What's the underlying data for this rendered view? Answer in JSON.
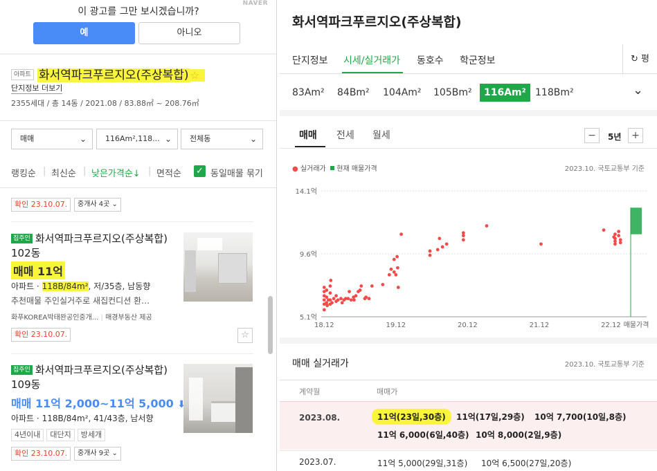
{
  "ad": {
    "question": "이 광고를 그만 보시겠습니까?",
    "brand": "NAVER",
    "yes": "예",
    "no": "아니오"
  },
  "complex": {
    "type_badge": "아파트",
    "name": "화서역파크푸르지오(주상복합)",
    "star": "☆",
    "more_info": "단지정보 더보기",
    "summary": "2355세대 / 총 14동 / 2021.08 / 83.88㎡ ~ 208.76㎡"
  },
  "filters": {
    "deal": "매매",
    "area": "116Am²,118...",
    "dong": "전체동"
  },
  "sort": {
    "rank": "랭킹순",
    "latest": "최신순",
    "cheap": "낮은가격순↓",
    "area": "면적순",
    "group": "동일매물 묶기"
  },
  "listings": [
    {
      "confirm": "확인 23.10.07.",
      "broker": "중개사 4곳"
    },
    {
      "badge": "집주인",
      "title": "화서역파크푸르지오(주상복합) 102동",
      "price": "매매 11억",
      "spec_prefix": "아파트 · ",
      "spec_area": "118B/84m²",
      "spec_rest": ", 저/35층, 남동향",
      "desc": "추천매물 주인실거주로 새집컨디션 환…",
      "source_left": "화푸KOREA박태완공인중개...",
      "source_right": "매경부동산 제공",
      "confirm": "확인 23.10.07."
    },
    {
      "badge": "집주인",
      "title": "화서역파크푸르지오(주상복합) 109동",
      "price": "매매 11억 2,000~11억 5,000",
      "spec": "아파트 · 118B/84m², 41/43층, 남서향",
      "tags": [
        "4년이내",
        "대단지",
        "방세개"
      ],
      "confirm": "확인 23.10.07.",
      "broker": "중개사 9곳"
    }
  ],
  "right": {
    "title": "화서역파크푸르지오(주상복합)",
    "tabs": [
      "단지정보",
      "시세/실거래가",
      "동호수",
      "학군정보"
    ],
    "share": "평",
    "types": [
      "83Am²",
      "84Bm²",
      "104Am²",
      "105Bm²",
      "116Am²",
      "118Bm²"
    ],
    "deal_tabs": [
      "매매",
      "전세",
      "월세"
    ],
    "period": "5년",
    "minus": "−",
    "plus": "+",
    "legend_real": "실거래가",
    "legend_current": "현재 매물가격",
    "source": "2023.10. 국토교통부 기준",
    "table_title": "매매 실거래가",
    "table_source": "2023.10. 국토교통부 기준",
    "col_date": "계약월",
    "col_price": "매매가",
    "rows": [
      {
        "date": "2023.08.",
        "line1": [
          "11억(23일,30층)",
          "11억(17일,29층)",
          "10억 7,700(10일,8층)"
        ],
        "line2": [
          "11억 6,000(6일,40층)",
          "10억 8,000(2일,9층)"
        ]
      },
      {
        "date": "2023.07.",
        "line1": [
          "11억 5,000(29일,31층)",
          "10억 6,500(27일,20층)"
        ]
      }
    ]
  },
  "colors": {
    "green": "#1fa749",
    "blue": "#4a8cf7",
    "highlight": "#f9f53b",
    "dot": "#f24b4b",
    "confirm_red": "#e8412c"
  },
  "chart_data": {
    "type": "scatter",
    "ylabels": [
      "14.1억",
      "9.6억",
      "5.1억"
    ],
    "xlabels": [
      "18.12",
      "19.12",
      "20.12",
      "21.12",
      "22.12",
      "매물가격"
    ],
    "ylim": [
      5.1,
      14.1
    ],
    "x_unit": "months since 2018.12",
    "current_price_range": [
      11.0,
      12.9
    ],
    "points": [
      [
        0,
        6.0
      ],
      [
        0,
        6.3
      ],
      [
        0,
        6.6
      ],
      [
        0,
        6.9
      ],
      [
        0,
        7.2
      ],
      [
        0,
        5.6
      ],
      [
        0.4,
        6.1
      ],
      [
        0.4,
        6.5
      ],
      [
        0.4,
        7.0
      ],
      [
        0.5,
        5.9
      ],
      [
        0.7,
        6.3
      ],
      [
        1,
        6.0
      ],
      [
        1,
        6.3
      ],
      [
        1,
        6.8
      ],
      [
        1,
        7.3
      ],
      [
        1.1,
        7.7
      ],
      [
        1.3,
        6.1
      ],
      [
        1.6,
        6.4
      ],
      [
        2,
        6.2
      ],
      [
        2,
        6.6
      ],
      [
        2.3,
        6.3
      ],
      [
        2.8,
        6.4
      ],
      [
        3,
        6.1
      ],
      [
        3.3,
        6.3
      ],
      [
        3.6,
        6.4
      ],
      [
        4,
        6.4
      ],
      [
        4.2,
        6.9
      ],
      [
        4.5,
        6.3
      ],
      [
        4.9,
        6.5
      ],
      [
        5,
        6.3
      ],
      [
        5.3,
        6.6
      ],
      [
        5.7,
        6.9
      ],
      [
        6,
        7.0
      ],
      [
        6.2,
        7.3
      ],
      [
        6.8,
        6.4
      ],
      [
        7,
        6.5
      ],
      [
        7.5,
        6.4
      ],
      [
        8,
        7.3
      ],
      [
        9.8,
        7.4
      ],
      [
        10.9,
        8.1
      ],
      [
        11.2,
        8.5
      ],
      [
        11.7,
        8.3
      ],
      [
        11.7,
        9.2
      ],
      [
        12,
        8.1
      ],
      [
        12.2,
        9.4
      ],
      [
        12.3,
        8.6
      ],
      [
        12.4,
        7.2
      ],
      [
        12.9,
        11.0
      ],
      [
        17.7,
        9.5
      ],
      [
        17.7,
        9.8
      ],
      [
        19,
        9.9
      ],
      [
        19.3,
        10.7
      ],
      [
        19.8,
        10.1
      ],
      [
        20.5,
        10.3
      ],
      [
        23.3,
        10.6
      ],
      [
        23.3,
        10.9
      ],
      [
        23.3,
        11.1
      ],
      [
        27.2,
        11.6
      ],
      [
        36.3,
        10.3
      ],
      [
        46.8,
        11.3
      ],
      [
        48.5,
        10.8
      ],
      [
        48.7,
        11.0
      ],
      [
        48.7,
        10.5
      ],
      [
        48.7,
        10.3
      ],
      [
        48.7,
        10.7
      ],
      [
        49.3,
        10.9
      ],
      [
        49.3,
        11.2
      ],
      [
        49.6,
        10.4
      ],
      [
        49.6,
        10.6
      ]
    ]
  }
}
